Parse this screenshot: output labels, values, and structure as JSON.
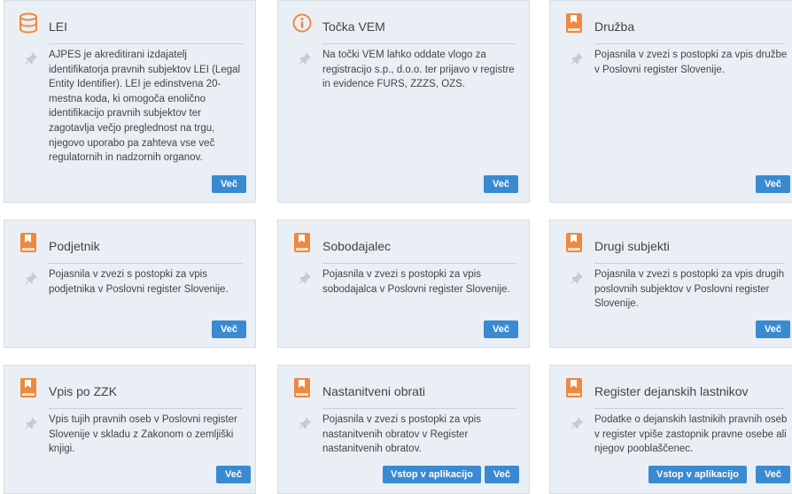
{
  "colors": {
    "accent": "#3a8ad2",
    "icon_orange": "#f0883e",
    "card_bg": "#e9eff5"
  },
  "cards": [
    {
      "title": "LEI",
      "icon": "database-icon",
      "description": "AJPES je akreditirani izdajatelj identifikatorja pravnih subjektov LEI (Legal Entity Identifier). LEI je edinstvena 20-mestna koda, ki omogoča enolično identifikacijo pravnih subjektov ter zagotavlja večjo preglednost na trgu, njegovo uporabo pa zahteva vse več regulatornih in nadzornih organov.",
      "more_label": "Več"
    },
    {
      "title": "Točka VEM",
      "icon": "info-icon",
      "description": "Na točki VEM lahko oddate vlogo za registracijo s.p., d.o.o. ter prijavo v registre in evidence FURS, ZZZS, OZS.",
      "more_label": "Več"
    },
    {
      "title": "Družba",
      "icon": "book-icon",
      "description": "Pojasnila v zvezi s postopki za vpis družbe v Poslovni register Slovenije.",
      "more_label": "Več"
    },
    {
      "title": "Podjetnik",
      "icon": "book-icon",
      "description": "Pojasnila v zvezi s postopki za vpis podjetnika v Poslovni register Slovenije.",
      "more_label": "Več"
    },
    {
      "title": "Sobodajalec",
      "icon": "book-icon",
      "description": "Pojasnila v zvezi s postopki za vpis sobodajalca v Poslovni register Slovenije.",
      "more_label": "Več"
    },
    {
      "title": "Drugi subjekti",
      "icon": "book-icon",
      "description": "Pojasnila v zvezi s postopki za vpis drugih poslovnih subjektov v Poslovni register Slovenije.",
      "more_label": "Več"
    },
    {
      "title": "Vpis po ZZK",
      "icon": "book-icon",
      "description": "Vpis tujih pravnih oseb v Poslovni register Slovenije v skladu z  Zakonom o zemljiški knjigi.",
      "more_label": "Več"
    },
    {
      "title": "Nastanitveni obrati",
      "icon": "book-icon",
      "description": "Pojasnila v zvezi s postopki za vpis nastanitvenih obratov v Register nastanitvenih obratov.",
      "more_label": "Več",
      "app_label": "Vstop v aplikacijo"
    },
    {
      "title": "Register dejanskih lastnikov",
      "icon": "book-icon",
      "description": "Podatke o dejanskih lastnikih pravnih oseb v register vpiše zastopnik pravne osebe ali njegov pooblaščenec.",
      "more_label": "Več",
      "app_label": "Vstop v aplikacijo"
    }
  ]
}
